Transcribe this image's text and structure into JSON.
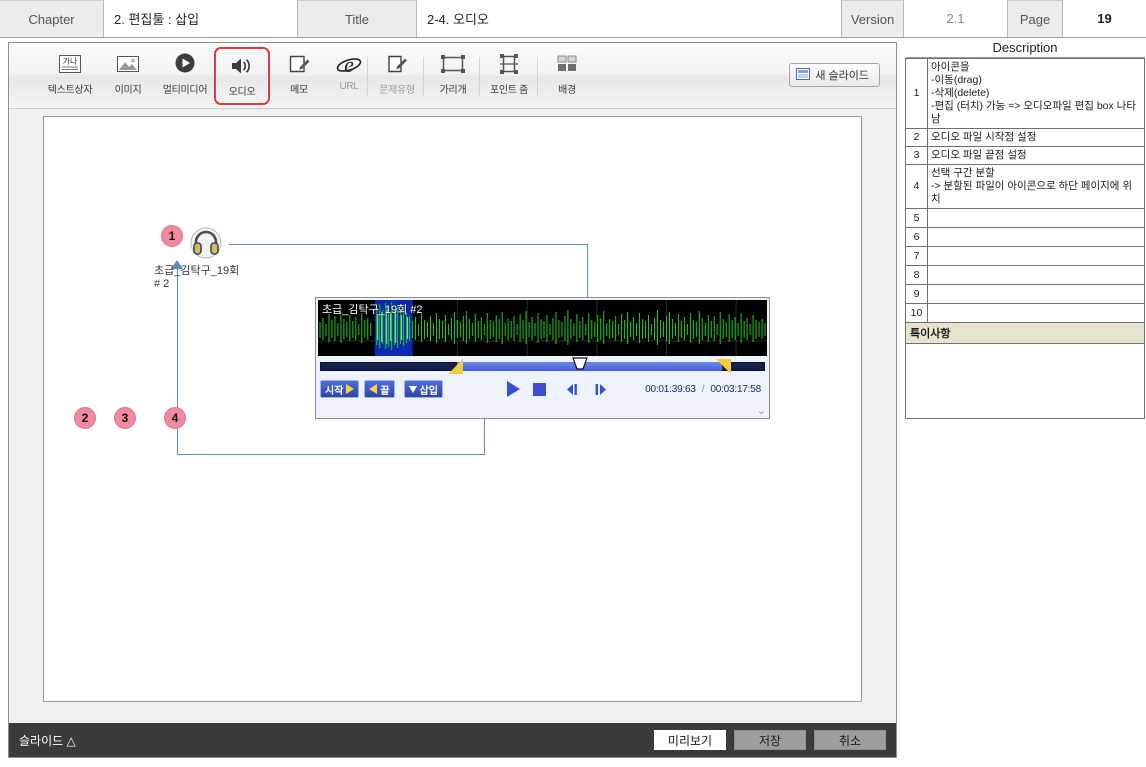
{
  "header": {
    "chapter_label": "Chapter",
    "chapter_value": "2. 편집툴 : 삽입",
    "title_label": "Title",
    "title_value": "2-4. 오디오",
    "version_label": "Version",
    "version_value": "2.1",
    "page_label": "Page",
    "page_value": "19"
  },
  "toolbar": {
    "items": [
      {
        "label": "텍스트상자",
        "icon": "text-box-icon",
        "selected": false
      },
      {
        "label": "이미지",
        "icon": "image-icon",
        "selected": false
      },
      {
        "label": "멀티미디어",
        "icon": "multimedia-play-icon",
        "selected": false
      },
      {
        "label": "오디오",
        "icon": "audio-speaker-icon",
        "selected": true
      },
      {
        "label": "메모",
        "icon": "memo-pencil-icon",
        "selected": false
      },
      {
        "label": "URL",
        "icon": "internet-explorer-icon",
        "selected": false
      },
      {
        "label": "문제유형",
        "icon": "quiz-pencil-icon",
        "selected": false
      },
      {
        "label": "가리개",
        "icon": "cover-rect-icon",
        "selected": false
      },
      {
        "label": "포인트 줌",
        "icon": "point-zoom-icon",
        "selected": false
      },
      {
        "label": "배경",
        "icon": "background-layout-icon",
        "selected": false
      }
    ],
    "new_slide_label": "새 슬라이드",
    "new_slide_icon": "slide-icon"
  },
  "canvas": {
    "audio_item": {
      "icon": "headphone-icon",
      "label_line1": "초급_김탁구_19회",
      "label_line2": "# 2",
      "badge": "1"
    },
    "audio_editor": {
      "waveform_title": "초급_김탁구_19회 #2",
      "buttons": [
        {
          "label": "시작",
          "icon": "start-marker-icon",
          "badge": "2"
        },
        {
          "label": "끝",
          "icon": "end-marker-icon",
          "badge": "3"
        },
        {
          "label": "삽입",
          "icon": "insert-down-arrow-icon",
          "badge": "4"
        }
      ],
      "transport": [
        {
          "name": "play-button",
          "icon": "play-icon"
        },
        {
          "name": "stop-button",
          "icon": "stop-icon"
        },
        {
          "name": "step-back-button",
          "icon": "step-back-icon"
        },
        {
          "name": "step-forward-button",
          "icon": "step-forward-icon"
        }
      ],
      "current_time": "00:01:39:63",
      "total_time": "00:03:17:58",
      "time_separator": "/"
    }
  },
  "bottom_bar": {
    "slide_label": "슬라이드 △",
    "preview_label": "미리보기",
    "save_label": "저장",
    "cancel_label": "취소"
  },
  "description": {
    "heading": "Description",
    "rows": [
      {
        "idx": "1",
        "text": "아이콘을\n-이동(drag)\n-삭제(delete)\n-편집 (터치) 가능 => 오디오파일 편집 box 나타남"
      },
      {
        "idx": "2",
        "text": "오디오 파일 시작점 설정"
      },
      {
        "idx": "3",
        "text": "오디오 파일 끝점 설정"
      },
      {
        "idx": "4",
        "text": "선택 구간 분할\n-> 분할된 파일이 아이콘으로 하단 페이지에 위치"
      },
      {
        "idx": "5",
        "text": ""
      },
      {
        "idx": "6",
        "text": ""
      },
      {
        "idx": "7",
        "text": ""
      },
      {
        "idx": "8",
        "text": ""
      },
      {
        "idx": "9",
        "text": ""
      },
      {
        "idx": "10",
        "text": ""
      }
    ],
    "special_heading": "특이사항",
    "special_text": ""
  },
  "colors": {
    "accent_red": "#e23b3b",
    "badge_pink": "#ef8aa0",
    "waveform_green": "#19d219",
    "selection_blue": "#4460d8",
    "special_header_bg": "#e6e4ce"
  }
}
